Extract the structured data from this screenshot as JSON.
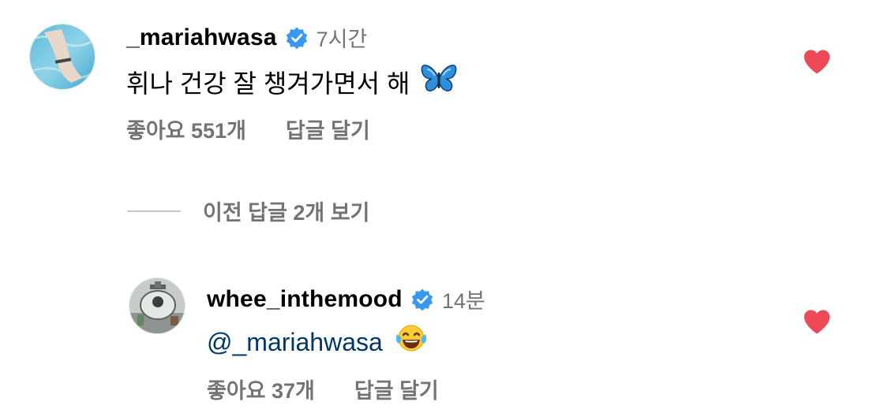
{
  "comments": [
    {
      "username": "_mariahwasa",
      "time": "7시간",
      "text": "휘나 건강 잘 챙겨가면서 해",
      "emoji": "butterfly-icon",
      "likes_label": "좋아요 551개",
      "reply_label": "답글 달기",
      "liked": true
    },
    {
      "username": "whee_inthemood",
      "time": "14분",
      "mention": "@_mariahwasa",
      "emoji": "tears-of-joy-icon",
      "likes_label": "좋아요 37개",
      "reply_label": "답글 달기",
      "liked": true
    }
  ],
  "view_replies_label": "이전 답글 2개 보기",
  "colors": {
    "verified": "#3897f0",
    "heart": "#ed4956",
    "secondary_text": "#737373",
    "mention": "#00376b"
  }
}
